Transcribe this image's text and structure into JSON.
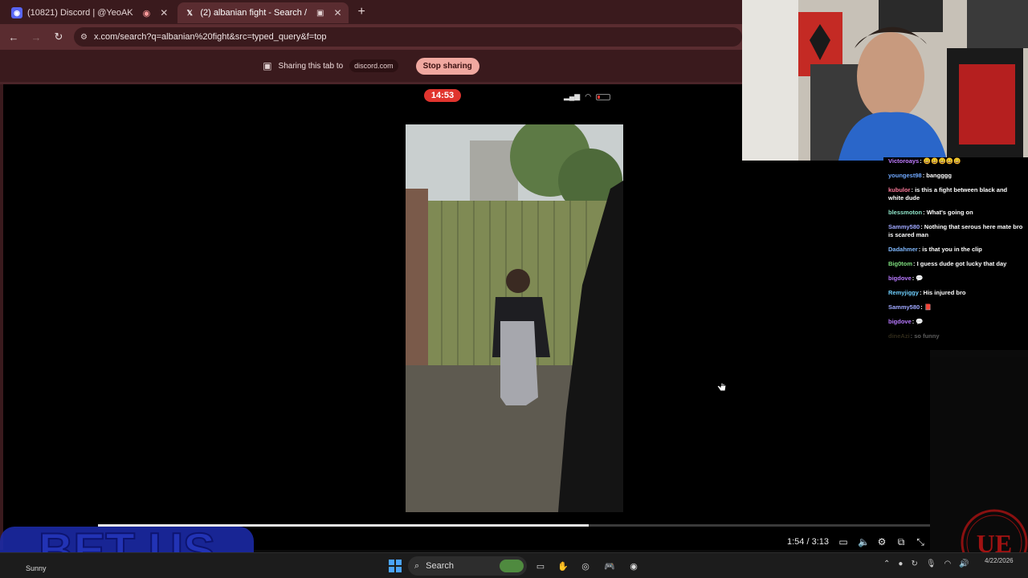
{
  "browser": {
    "tabs": [
      {
        "title": "(10821) Discord | @YeoAK",
        "favicon": "discord-icon",
        "active": false
      },
      {
        "title": "(2) albanian fight - Search /",
        "favicon": "x-icon",
        "active": true
      }
    ],
    "new_tab_symbol": "+",
    "close_symbol": "✕",
    "url": "x.com/search?q=albanian%20fight&src=typed_query&f=top"
  },
  "sharebar": {
    "text": "Sharing this tab to",
    "target": "discord.com",
    "stop_label": "Stop sharing"
  },
  "phone": {
    "time": "14:53"
  },
  "video": {
    "time_display": "1:54 / 3:13",
    "progress": 0.59
  },
  "chat": {
    "messages": [
      {
        "user": "Victoroays",
        "text": "😄😄😄😄😄",
        "color": "#c07cff",
        "faded": false
      },
      {
        "user": "youngest98",
        "text": "bangggg",
        "color": "#6fa8ff",
        "faded": false
      },
      {
        "user": "kubulor",
        "text": "is this a fight between black and white dude",
        "color": "#ff7b9c",
        "faded": false
      },
      {
        "user": "blessmoton",
        "text": "What's going on",
        "color": "#8fe3c8",
        "faded": false
      },
      {
        "user": "Sammy580",
        "text": "Nothing that serous here mate bro is scared man",
        "color": "#9fa8ff",
        "faded": false
      },
      {
        "user": "Dadahmer",
        "text": "is that you in the clip",
        "color": "#7fb8ff",
        "faded": false
      },
      {
        "user": "Big0tom",
        "text": "I guess dude got lucky that day",
        "color": "#7fe07f",
        "faded": false
      },
      {
        "user": "bigdove",
        "text": "💬",
        "color": "#b879ff",
        "faded": false
      },
      {
        "user": "Remyjiggy",
        "text": "His injured bro",
        "color": "#6fd0ff",
        "faded": false
      },
      {
        "user": "Sammy580",
        "text": "📕",
        "color": "#9fa8ff",
        "faded": false
      },
      {
        "user": "bigdove",
        "text": "💬",
        "color": "#b879ff",
        "faded": false
      },
      {
        "user": "dineAzi",
        "text": "so funny",
        "color": "#8a7a4a",
        "faded": true
      }
    ]
  },
  "taskbar": {
    "search_label": "Search",
    "weather": "Sunny",
    "clock_time": "4/22/2026"
  },
  "overlay": {
    "logo_text": "BET US",
    "badge_text": "UE"
  }
}
